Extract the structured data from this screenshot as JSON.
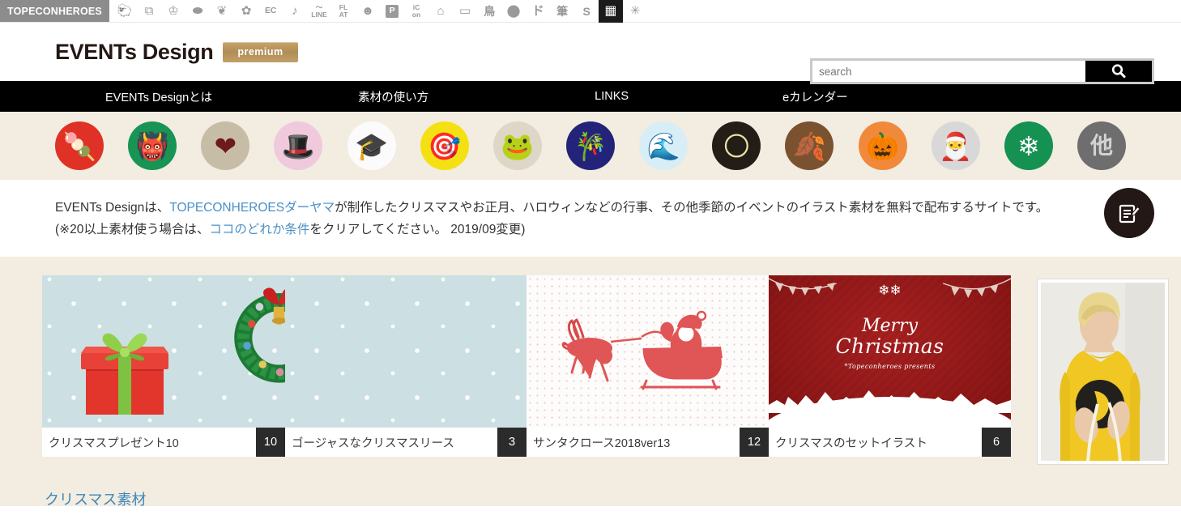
{
  "topbar": {
    "brand": "TOPECONHEROES",
    "icons": [
      {
        "name": "sheep-icon",
        "glyph": "🐑"
      },
      {
        "name": "copy-squares-icon",
        "glyph": "⧉"
      },
      {
        "name": "person-cheer-icon",
        "glyph": "ὗ"
      },
      {
        "name": "speech-bubble-icon",
        "glyph": "⬬"
      },
      {
        "name": "leaf-icon",
        "glyph": "❦"
      },
      {
        "name": "flower-icon",
        "glyph": "✿"
      },
      {
        "name": "ec-icon",
        "glyph": "EC"
      },
      {
        "name": "music-note-icon",
        "glyph": "♪"
      },
      {
        "name": "line-icon",
        "glyph": "LINE"
      },
      {
        "name": "flat-icon",
        "glyph": "FL\nAT"
      },
      {
        "name": "smiley-icon",
        "glyph": "☻"
      },
      {
        "name": "parking-p-icon",
        "glyph": "P"
      },
      {
        "name": "icon-icon",
        "glyph": "iC\non"
      },
      {
        "name": "building-icon",
        "glyph": "⌂"
      },
      {
        "name": "sofa-icon",
        "glyph": "═"
      },
      {
        "name": "bird-kanji-icon",
        "glyph": "鳥"
      },
      {
        "name": "dark-circle-icon",
        "glyph": "⬤"
      },
      {
        "name": "katakana-do-icon",
        "glyph": "ド"
      },
      {
        "name": "brush-kanji-icon",
        "glyph": "筆"
      },
      {
        "name": "s-star-icon",
        "glyph": "S"
      },
      {
        "name": "grid-icon",
        "glyph": "▒"
      },
      {
        "name": "sparkle-icon",
        "glyph": "✳"
      }
    ]
  },
  "header": {
    "logo": "EVENTs Design",
    "premium_badge": "premium",
    "search": {
      "placeholder": "search",
      "value": "",
      "button_icon": "search-icon"
    }
  },
  "nav": {
    "items": [
      {
        "label": "EVENTs Designとは"
      },
      {
        "label": "素材の使い方"
      },
      {
        "label": "LINKS"
      },
      {
        "label": "eカレンダー"
      }
    ]
  },
  "categories": [
    {
      "name": "kagami-mochi",
      "label": "🍡",
      "bg": "#e03127"
    },
    {
      "name": "setsubun-oni",
      "label": "👹",
      "bg": "#189455"
    },
    {
      "name": "valentine-heart",
      "label": "❤",
      "bg": "#c7bda6"
    },
    {
      "name": "hinamatsuri-doll",
      "label": "🎎",
      "bg": "#f0c9dc"
    },
    {
      "name": "graduation-sakura",
      "label": "🎓",
      "bg": "#fbfbfb"
    },
    {
      "name": "koinobori",
      "label": "🎏",
      "bg": "#f5e113"
    },
    {
      "name": "tsuyu-frog",
      "label": "🐸",
      "bg": "#ded6c6"
    },
    {
      "name": "tanabata",
      "label": "🎋",
      "bg": "#23237a"
    },
    {
      "name": "summer-sea",
      "label": "🌊",
      "bg": "#d8eef7"
    },
    {
      "name": "tsukimi",
      "label": "🌕",
      "bg": "#231d18"
    },
    {
      "name": "autumn-leaf",
      "label": "🍂",
      "bg": "#7a5230"
    },
    {
      "name": "halloween-pumpkin",
      "label": "🎃",
      "bg": "#f0893a"
    },
    {
      "name": "christmas-santa",
      "label": "🎅",
      "bg": "#d8d8d8"
    },
    {
      "name": "winter-snowflake",
      "label": "❄",
      "bg": "#159152"
    },
    {
      "name": "other-category",
      "label": "他",
      "bg": "#6e6e6e"
    }
  ],
  "description": {
    "line1_part1": "EVENTs Designは、",
    "line1_link": "TOPECONHEROESダーヤマ",
    "line1_part2": "が制作したクリスマスやお正月、ハロウィンなどの行事、その他季節のイベントのイラスト素材を無料で配布するサイトです。",
    "line2_part1": "(※20以上素材使う場合は、",
    "line2_link": "ココのどれか条件",
    "line2_part2": "をクリアしてください。 2019/09変更)",
    "fab_icon": "note-edit-icon"
  },
  "gallery": {
    "cards": [
      {
        "title": "クリスマスプレゼント10",
        "count": "10",
        "thumb": "christmas-present-gift-box"
      },
      {
        "title": "ゴージャスなクリスマスリース",
        "count": "3",
        "thumb": "christmas-wreath"
      },
      {
        "title": "サンタクロース2018ver13",
        "count": "12",
        "thumb": "santa-sleigh-reindeer"
      },
      {
        "title": "クリスマスのセットイラスト",
        "count": "6",
        "thumb": "merry-christmas-red-card"
      }
    ]
  },
  "xmas_card": {
    "line1": "Merry",
    "line2": "Christmas",
    "subtitle": "*Topeconheroes presents"
  },
  "ad": {
    "name": "sidebar-advertisement",
    "alt": "blond-man-yellow-tshirt-photo"
  },
  "section_link": {
    "label": "クリスマス素材"
  },
  "colors": {
    "cream": "#f2ece1",
    "nav_black": "#000000",
    "link_blue": "#4c8fc4",
    "premium_gold": "#b08d55",
    "badge_dark": "#2b2b2b"
  }
}
